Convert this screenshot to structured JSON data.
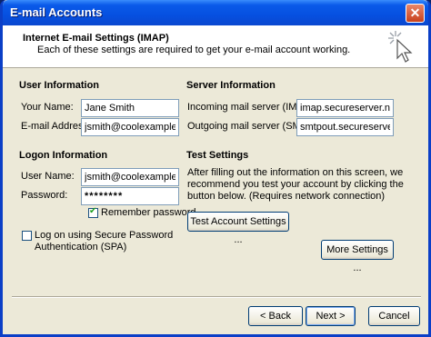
{
  "window": {
    "title": "E-mail Accounts",
    "close_glyph": "✕"
  },
  "header": {
    "title": "Internet E-mail Settings (IMAP)",
    "subtitle": "Each of these settings are required to get your e-mail account working."
  },
  "user_info": {
    "heading": "User Information",
    "name_label": "Your Name:",
    "name_value": "Jane Smith",
    "email_label": "E-mail Address:",
    "email_value": "jsmith@coolexample.com"
  },
  "server_info": {
    "heading": "Server Information",
    "incoming_label": "Incoming mail server (IMAP):",
    "incoming_value": "imap.secureserver.net",
    "outgoing_label": "Outgoing mail server (SMTP):",
    "outgoing_value": "smtpout.secureserver.net"
  },
  "logon_info": {
    "heading": "Logon Information",
    "username_label": "User Name:",
    "username_value": "jsmith@coolexample.com",
    "password_label": "Password:",
    "password_value": "********",
    "remember_label": "Remember password",
    "remember_checked": true,
    "spa_label_1": "Log on using Secure Password",
    "spa_label_2": "Authentication (SPA)",
    "spa_checked": false
  },
  "test_settings": {
    "heading": "Test Settings",
    "description_1": "After filling out the information on this screen, we",
    "description_2": "recommend you test your account by clicking the",
    "description_3": "button below. (Requires network connection)",
    "test_button": "Test Account Settings ..."
  },
  "more_settings_button": "More Settings ...",
  "footer": {
    "back_button": "< Back",
    "next_button": "Next >",
    "cancel_button": "Cancel"
  },
  "colors": {
    "titlebar": "#0a5ae9",
    "dialog_bg": "#ece9d8",
    "field_border": "#7f9db9"
  },
  "icons": [
    "close-icon",
    "wizard-cursor-icon",
    "checkmark-icon"
  ]
}
